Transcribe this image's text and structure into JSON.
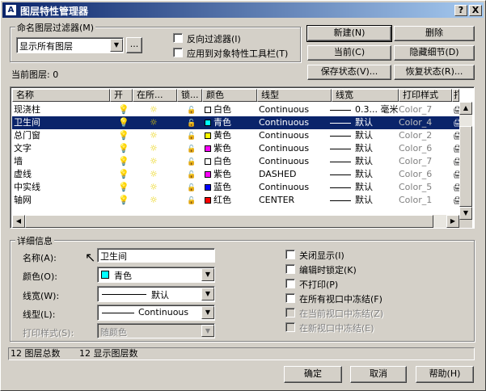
{
  "window": {
    "title": "图层特性管理器",
    "help_btn": "?",
    "close_btn": "X"
  },
  "filter": {
    "group_label": "命名图层过滤器(M)",
    "selected": "显示所有图层",
    "more_btn": "...",
    "invert_label": "反向过滤器(I)",
    "apply_label": "应用到对象特性工具栏(T)"
  },
  "current_layer": {
    "label": "当前图层: 0"
  },
  "buttons": {
    "new": "新建(N)",
    "delete": "删除",
    "current": "当前(C)",
    "hide_details": "隐藏细节(D)",
    "save_state": "保存状态(V)...",
    "restore_state": "恢复状态(R)..."
  },
  "table": {
    "headers": [
      "名称",
      "开",
      "在所...",
      "锁...",
      "颜色",
      "线型",
      "线宽",
      "打印样式",
      "打"
    ],
    "rows": [
      {
        "name": "现浇柱",
        "color": "白色",
        "color_hex": "#ffffff",
        "linetype": "Continuous",
        "lineweight": "0.3... 毫米",
        "plot_style": "Color_7",
        "selected": false
      },
      {
        "name": "卫生间",
        "color": "青色",
        "color_hex": "#00ffff",
        "linetype": "Continuous",
        "lineweight": "默认",
        "plot_style": "Color_4",
        "selected": true
      },
      {
        "name": "总门窗",
        "color": "黄色",
        "color_hex": "#ffff00",
        "linetype": "Continuous",
        "lineweight": "默认",
        "plot_style": "Color_2",
        "selected": false
      },
      {
        "name": "文字",
        "color": "紫色",
        "color_hex": "#ff00ff",
        "linetype": "Continuous",
        "lineweight": "默认",
        "plot_style": "Color_6",
        "selected": false
      },
      {
        "name": "墙",
        "color": "白色",
        "color_hex": "#ffffff",
        "linetype": "Continuous",
        "lineweight": "默认",
        "plot_style": "Color_7",
        "selected": false
      },
      {
        "name": "虚线",
        "color": "紫色",
        "color_hex": "#ff00ff",
        "linetype": "DASHED",
        "lineweight": "默认",
        "plot_style": "Color_6",
        "selected": false
      },
      {
        "name": "中实线",
        "color": "蓝色",
        "color_hex": "#0000ff",
        "linetype": "Continuous",
        "lineweight": "默认",
        "plot_style": "Color_5",
        "selected": false
      },
      {
        "name": "轴网",
        "color": "红色",
        "color_hex": "#ff0000",
        "linetype": "CENTER",
        "lineweight": "默认",
        "plot_style": "Color_1",
        "selected": false
      }
    ]
  },
  "details": {
    "group_label": "详细信息",
    "name_label": "名称(A):",
    "name_value": "卫生间",
    "color_label": "颜色(O):",
    "color_value": "青色",
    "color_hex": "#00ffff",
    "lineweight_label": "线宽(W):",
    "lineweight_value": "默认",
    "linetype_label": "线型(L):",
    "linetype_value": "Continuous",
    "plotstyle_label": "打印样式(S):",
    "plotstyle_value": "随颜色",
    "checks": {
      "off": "关闭显示(I)",
      "lock": "编辑时锁定(K)",
      "noplot": "不打印(P)",
      "freeze_all": "在所有视口中冻结(F)",
      "freeze_current": "在当前视口中冻结(Z)",
      "freeze_new": "在新视口中冻结(E)"
    }
  },
  "status": {
    "total": "12 图层总数",
    "shown": "12 显示图层数"
  },
  "footer": {
    "ok": "确定",
    "cancel": "取消",
    "help": "帮助(H)"
  }
}
